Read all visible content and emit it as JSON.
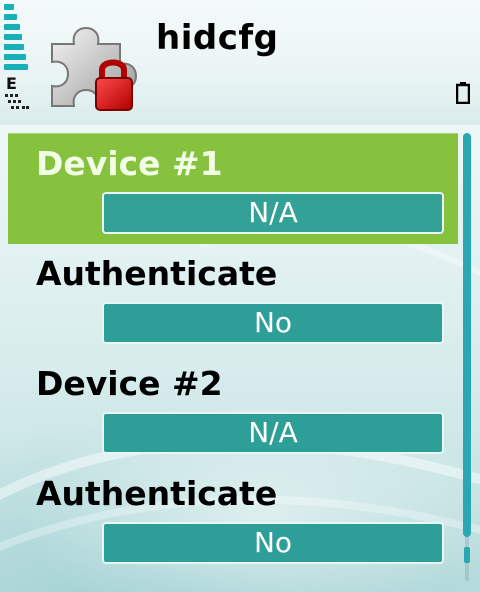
{
  "header": {
    "title": "hidcfg",
    "network_type": "E",
    "icons": {
      "app": "puzzle-lock-icon",
      "signal": "signal-strength-icon",
      "battery": "battery-icon"
    }
  },
  "settings": {
    "items": [
      {
        "label": "Device #1",
        "value": "N/A",
        "selected": true
      },
      {
        "label": "Authenticate",
        "value": "No",
        "selected": false
      },
      {
        "label": "Device #2",
        "value": "N/A",
        "selected": false
      },
      {
        "label": "Authenticate",
        "value": "No",
        "selected": false
      }
    ]
  },
  "colors": {
    "selection": "#86c23e",
    "value_box": "#2e9e98",
    "accent": "#17b0b8"
  }
}
